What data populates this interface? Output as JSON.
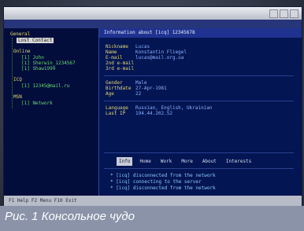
{
  "window": {
    "title": "",
    "menu": [
      "",
      "",
      "",
      ""
    ]
  },
  "tree": {
    "root": "General",
    "selected": "Lost Contact",
    "group_online": "Online",
    "group_online_items": [
      "[1] John",
      "[1] Sherwin_1234567",
      "[1] Shaw1999"
    ],
    "group_icq": "ICQ",
    "group_icq_items": [
      "[1] 12345@mail.ru"
    ],
    "group_other": "MSN",
    "group_other_items": [
      "[1] Network"
    ]
  },
  "info": {
    "header": "Information about [icq] 12345678",
    "fields": [
      {
        "label": "Nickname",
        "value": "Lucas"
      },
      {
        "label": "Name",
        "value": "Konstantin Fliegel"
      },
      {
        "label": "E-mail",
        "value": "lucas@mail.org.ua"
      },
      {
        "label": "2nd e-mail",
        "value": ""
      },
      {
        "label": "3rd e-mail",
        "value": ""
      }
    ],
    "fields2": [
      {
        "label": "Gender",
        "value": "Male"
      },
      {
        "label": "Birthdate",
        "value": "27-Apr-1981"
      },
      {
        "label": "Age",
        "value": "22"
      }
    ],
    "fields3": [
      {
        "label": "Language",
        "value": "Russian, English, Ukrainian"
      },
      {
        "label": "Last IP",
        "value": "194.44.202.52"
      }
    ]
  },
  "tabs": [
    "Info",
    "Home",
    "Work",
    "More",
    "About",
    "Interests"
  ],
  "log": [
    "* [icq] disconnected from the network",
    "* [icq] connecting to the server",
    "* [icq] disconnected from the network"
  ],
  "status": "F1 Help  F2 Menu  F10 Exit",
  "caption": "Рис. 1 Консольное чудо"
}
